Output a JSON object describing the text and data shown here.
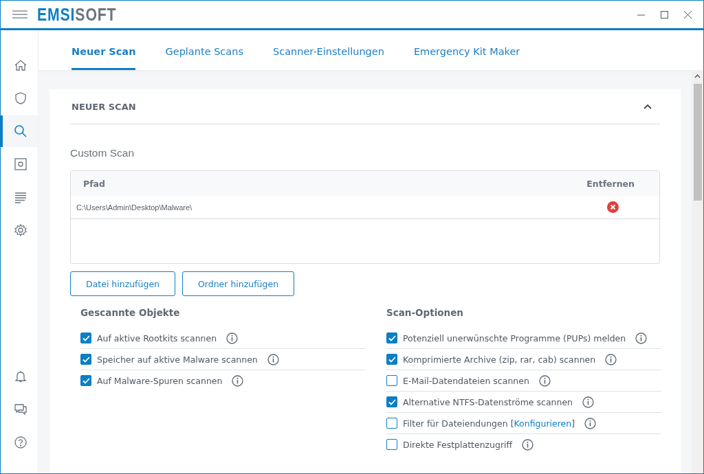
{
  "window": {
    "logo_primary": "EMSI",
    "logo_secondary": "SOFT"
  },
  "sidebar": {
    "items": [
      {
        "selected": false
      },
      {
        "selected": false
      },
      {
        "selected": true
      },
      {
        "selected": false
      },
      {
        "selected": false
      },
      {
        "selected": false
      }
    ]
  },
  "tabs": [
    {
      "label": "Neuer Scan",
      "selected": true
    },
    {
      "label": "Geplante Scans",
      "selected": false
    },
    {
      "label": "Scanner-Einstellungen",
      "selected": false
    },
    {
      "label": "Emergency Kit Maker",
      "selected": false
    }
  ],
  "section": {
    "title": "NEUER SCAN",
    "expanded": true,
    "subtitle": "Custom Scan",
    "table": {
      "columns": [
        "Pfad",
        "Entfernen"
      ],
      "rows": [
        {
          "path": "C:\\Users\\Admin\\Desktop\\Malware\\"
        }
      ]
    },
    "buttons": [
      "Datei hinzufügen",
      "Ordner hinzufügen"
    ],
    "groups": [
      {
        "title": "Gescannte Objekte",
        "options": [
          {
            "label": "Auf aktive Rootkits scannen",
            "checked": true
          },
          {
            "label": "Speicher auf aktive Malware scannen",
            "checked": true
          },
          {
            "label": "Auf Malware-Spuren scannen",
            "checked": true
          }
        ]
      },
      {
        "title": "Scan-Optionen",
        "options": [
          {
            "label": "Potenziell unerwünschte Programme (PUPs) melden",
            "checked": true
          },
          {
            "label": "Komprimierte Archive (zip, rar, cab) scannen",
            "checked": true
          },
          {
            "label": "E-Mail-Datendateien scannen",
            "checked": false
          },
          {
            "label": "Alternative NTFS-Datenströme scannen",
            "checked": true
          },
          {
            "label": "Filter für Dateiendungen [",
            "link": "Konfigurieren",
            "label_end": "]",
            "checked": false
          },
          {
            "label": "Direkte Festplattenzugriff",
            "checked": false
          }
        ]
      }
    ]
  }
}
